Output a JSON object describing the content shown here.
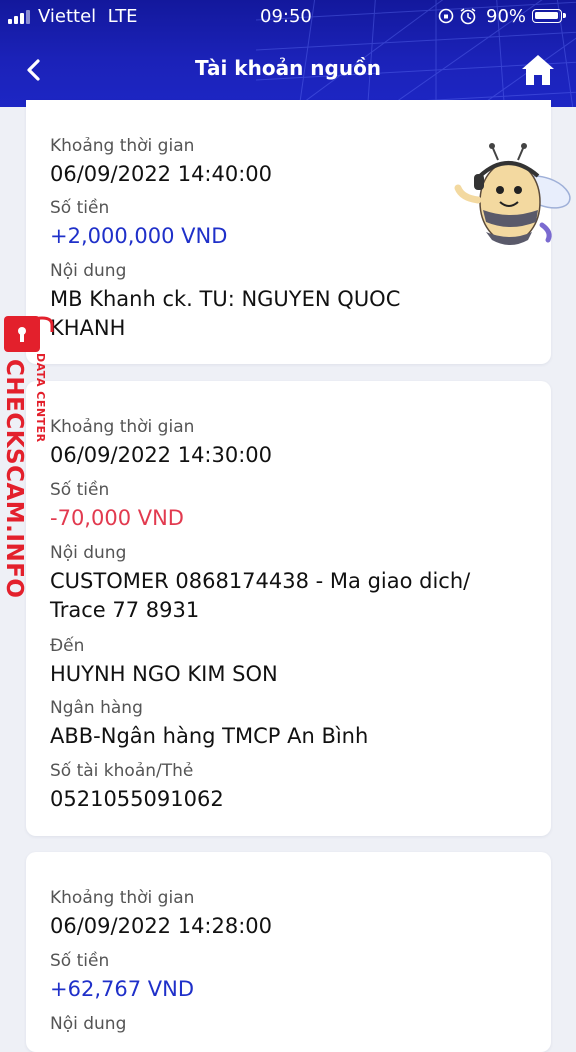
{
  "status_bar": {
    "carrier": "Viettel",
    "network": "LTE",
    "time": "09:50",
    "battery": "90%"
  },
  "header": {
    "title": "Tài khoản nguồn",
    "back_icon": "chevron-left-icon",
    "home_icon": "home-icon"
  },
  "colors": {
    "header": "#1b22b8",
    "positive_amount": "#1f30c9",
    "negative_amount": "#e23a4f",
    "watermark": "#e3202c"
  },
  "transactions": [
    {
      "time_label": "Khoảng thời gian",
      "time": "06/09/2022 14:40:00",
      "amount_label": "Số tiền",
      "amount": "+2,000,000 VND",
      "content_label": "Nội dung",
      "content": "MB Khanh ck. TU: NGUYEN QUOC KHANH"
    },
    {
      "time_label": "Khoảng thời gian",
      "time": "06/09/2022 14:30:00",
      "amount_label": "Số tiền",
      "amount": "-70,000 VND",
      "content_label": "Nội dung",
      "content": "CUSTOMER 0868174438 - Ma giao dich/ Trace 77 8931",
      "to_label": "Đến",
      "to": "HUYNH NGO KIM SON",
      "bank_label": "Ngân hàng",
      "bank": "ABB-Ngân hàng TMCP An Bình",
      "account_label": "Số tài khoản/Thẻ",
      "account": "0521055091062"
    },
    {
      "time_label": "Khoảng thời gian",
      "time": "06/09/2022 14:28:00",
      "amount_label": "Số tiền",
      "amount": "+62,767 VND",
      "content_label": "Nội dung"
    }
  ],
  "watermark": {
    "text": "CHECKSCAM.INFO",
    "subtext": "DATA CENTER"
  }
}
